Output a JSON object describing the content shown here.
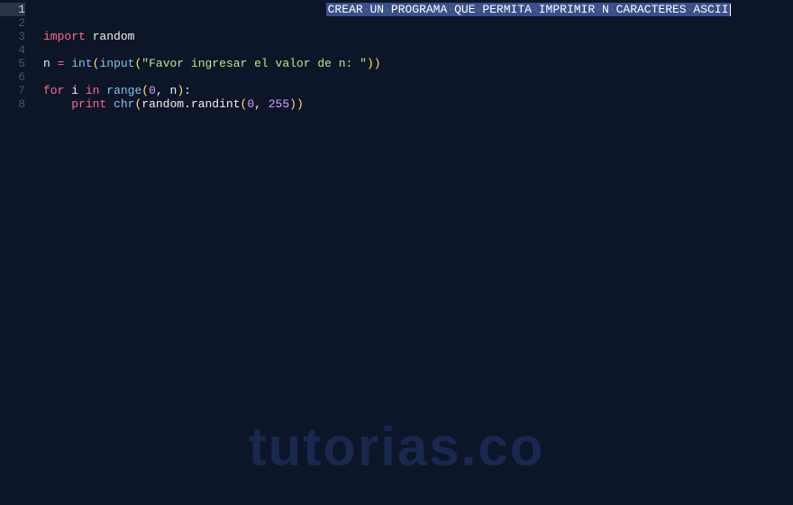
{
  "editor": {
    "lines": [
      {
        "num": "1",
        "active": true
      },
      {
        "num": "2"
      },
      {
        "num": "3"
      },
      {
        "num": "4"
      },
      {
        "num": "5"
      },
      {
        "num": "6"
      },
      {
        "num": "7"
      },
      {
        "num": "8"
      }
    ],
    "selection_tokens": [
      "CREAR",
      "UN",
      "PROGRAMA",
      "QUE",
      "PERMITA",
      "IMPRIMIR",
      "N",
      "CARACTERES",
      "ASCII"
    ],
    "line3": {
      "kw": "import",
      "mod": "random"
    },
    "line5": {
      "var": "n",
      "eq": "=",
      "fn1": "int",
      "fn2": "input",
      "str": "\"Favor ingresar el valor de n: \""
    },
    "line7": {
      "kw1": "for",
      "var": "i",
      "kw2": "in",
      "fn": "range",
      "n1": "0",
      "n2": "n"
    },
    "line8": {
      "kw": "print",
      "fn": "chr",
      "mod": "random",
      "meth": "randint",
      "n1": "0",
      "n2": "255"
    }
  },
  "watermark": "tutorias.co"
}
